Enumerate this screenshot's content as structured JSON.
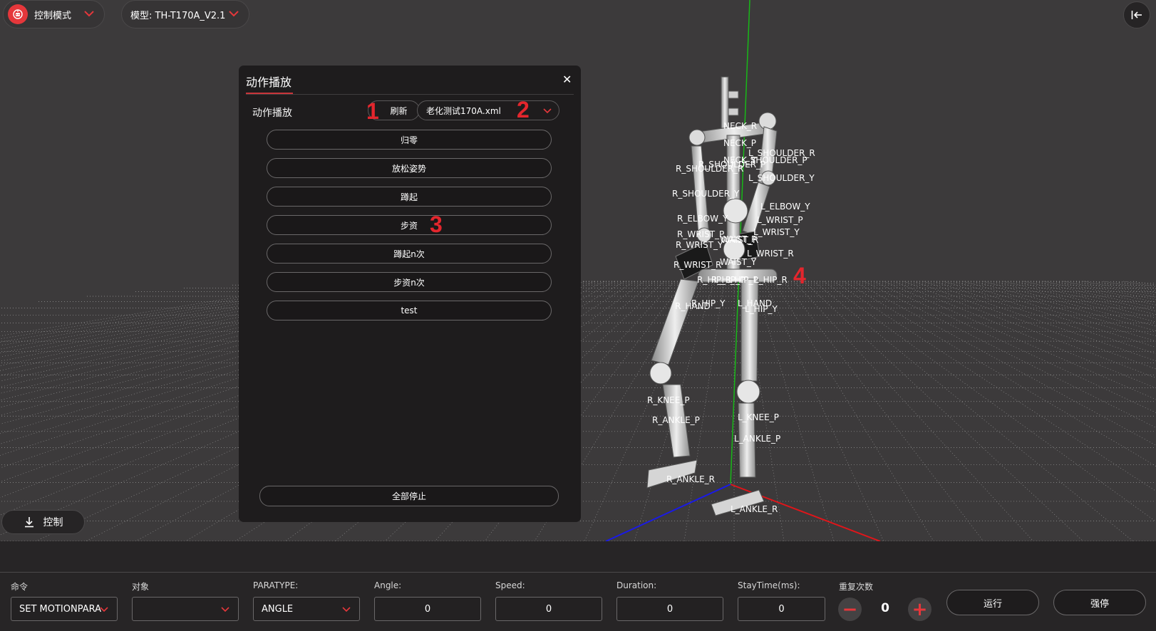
{
  "header": {
    "mode_label": "控制模式",
    "model_label": "模型: TH-T170A_V2.1"
  },
  "viewport": {
    "control_button_label": "控制",
    "joint_labels": [
      "NECK_R",
      "NECK_P",
      "L_SHOULDER_R",
      "NECK_Y",
      "L_SHOULDER_P",
      "R_SHOULDER_R",
      "R_SHOULDER_P",
      "L_SHOULDER_Y",
      "R_SHOULDER_Y",
      "L_ELBOW_Y",
      "R_ELBOW_Y",
      "L_WRIST_P",
      "R_WRIST_P",
      "L_WRIST_Y",
      "WAIST_R",
      "R_WRIST_Y",
      "WAIST_P",
      "L_WRIST_R",
      "WAIST_Y",
      "R_WRIST_R",
      "R_HIP_R",
      "R_HIP_P",
      "L_HIP_P",
      "L_HIP_R",
      "R_HIP_Y",
      "L_HAND",
      "R_HAND",
      "L_HIP_Y",
      "R_KNEE_P",
      "R_ANKLE_P",
      "L_KNEE_P",
      "L_ANKLE_P",
      "R_ANKLE_R",
      "L_ANKLE_R"
    ]
  },
  "dialog": {
    "title": "动作播放",
    "close_symbol": "✕",
    "section_label": "动作播放",
    "refresh_label": "刷新",
    "file_value": "老化测试170A.xml",
    "actions": [
      "归零",
      "放松姿势",
      "蹲起",
      "步资",
      "蹲起n次",
      "步资n次",
      "test"
    ],
    "stop_all_label": "全部停止"
  },
  "markers": [
    "1",
    "2",
    "3",
    "4"
  ],
  "bottom": {
    "command_label": "命令",
    "command_value": "SET MOTIONPARA",
    "target_label": "对象",
    "target_value": "",
    "paratype_label": "PARATYPE:",
    "paratype_value": "ANGLE",
    "angle_label": "Angle:",
    "angle_value": "0",
    "speed_label": "Speed:",
    "speed_value": "0",
    "duration_label": "Duration:",
    "duration_value": "0",
    "staytime_label": "StayTime(ms):",
    "staytime_value": "0",
    "repeat_label": "重复次数",
    "repeat_value": "0",
    "minus_symbol": "−",
    "plus_symbol": "+",
    "run_label": "运行",
    "estop_label": "强停"
  },
  "colors": {
    "accent": "#e5373b",
    "background": "#3c3a3b",
    "panel": "#1e1c1d",
    "axis_x": "#e0151a",
    "axis_y": "#18b818",
    "axis_z": "#1a1ae6"
  }
}
